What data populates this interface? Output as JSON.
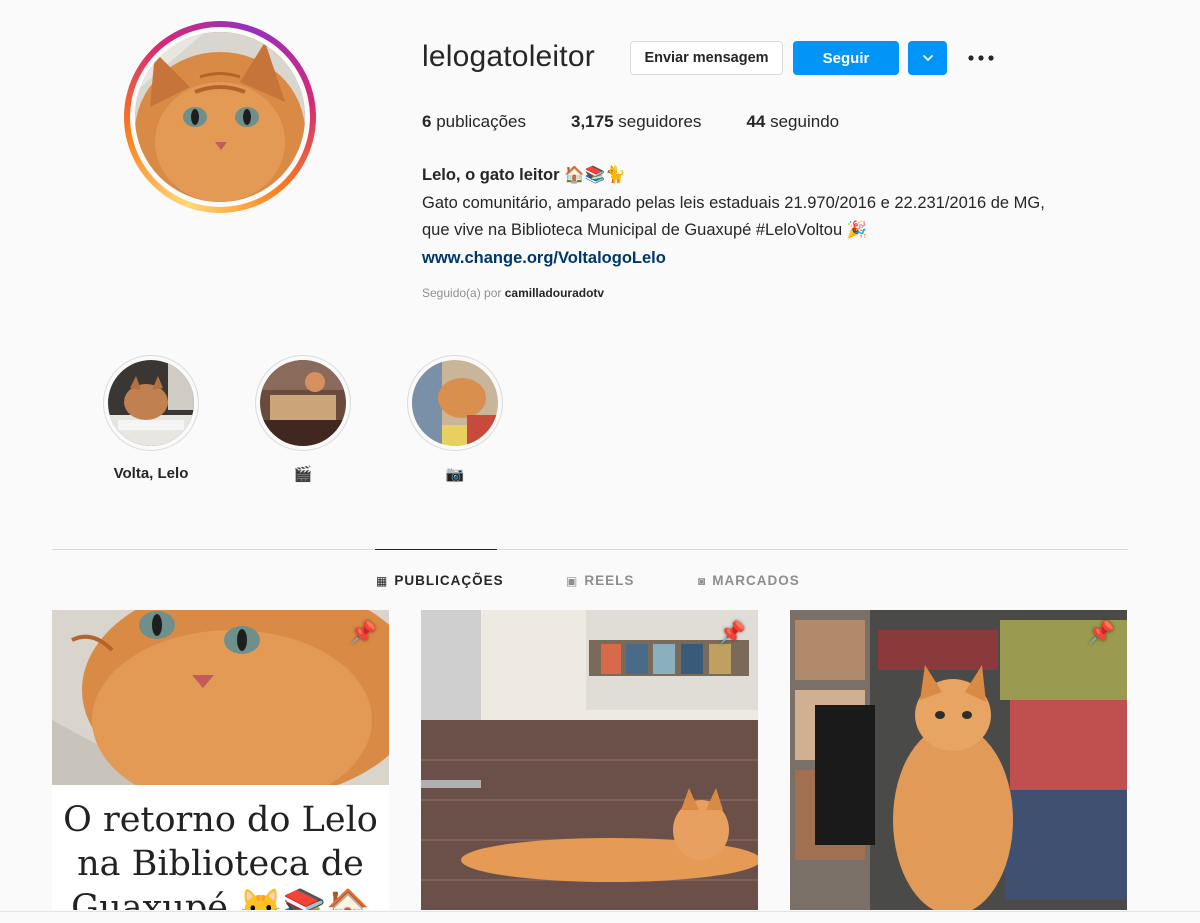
{
  "profile": {
    "username": "lelogatoleitor",
    "buttons": {
      "message": "Enviar mensagem",
      "follow": "Seguir",
      "dropdown": "⌄",
      "more": "•••"
    },
    "stats": [
      {
        "count": "6",
        "label": "publicações"
      },
      {
        "count": "3,175",
        "label": "seguidores"
      },
      {
        "count": "44",
        "label": "seguindo"
      }
    ],
    "bio": {
      "name": "Lelo, o gato leitor 🏠📚🐈",
      "line1": "Gato comunitário, amparado pelas leis estaduais 21.970/2016 e 22.231/2016 de MG,",
      "line2": "que vive na Biblioteca Municipal de Guaxupé #LeloVoltou 🎉",
      "link": "www.change.org/VoltalogoLelo"
    },
    "followed_by": {
      "prefix": "Seguido(a) por",
      "user": "camilladouradotv"
    }
  },
  "highlights": [
    {
      "label": "Volta, Lelo"
    },
    {
      "label": "🎬"
    },
    {
      "label": "📷"
    }
  ],
  "tabs": [
    {
      "icon": "▦",
      "label": "PUBLICAÇÕES",
      "active": true
    },
    {
      "icon": "▣",
      "label": "REELS",
      "active": false
    },
    {
      "icon": "◙",
      "label": "MARCADOS",
      "active": false
    }
  ],
  "posts": [
    {
      "pinned_icon": "📌",
      "caption_line1": "O retorno do Lelo",
      "caption_line2": "na Biblioteca de",
      "caption_line3": "Guaxupé 🐱📚🏠"
    },
    {
      "pinned_icon": "📌"
    },
    {
      "pinned_icon": "📌"
    }
  ],
  "colors": {
    "accent": "#0095f6",
    "link": "#00376b",
    "muted": "#8e8e8e",
    "border": "#dbdbdb"
  }
}
